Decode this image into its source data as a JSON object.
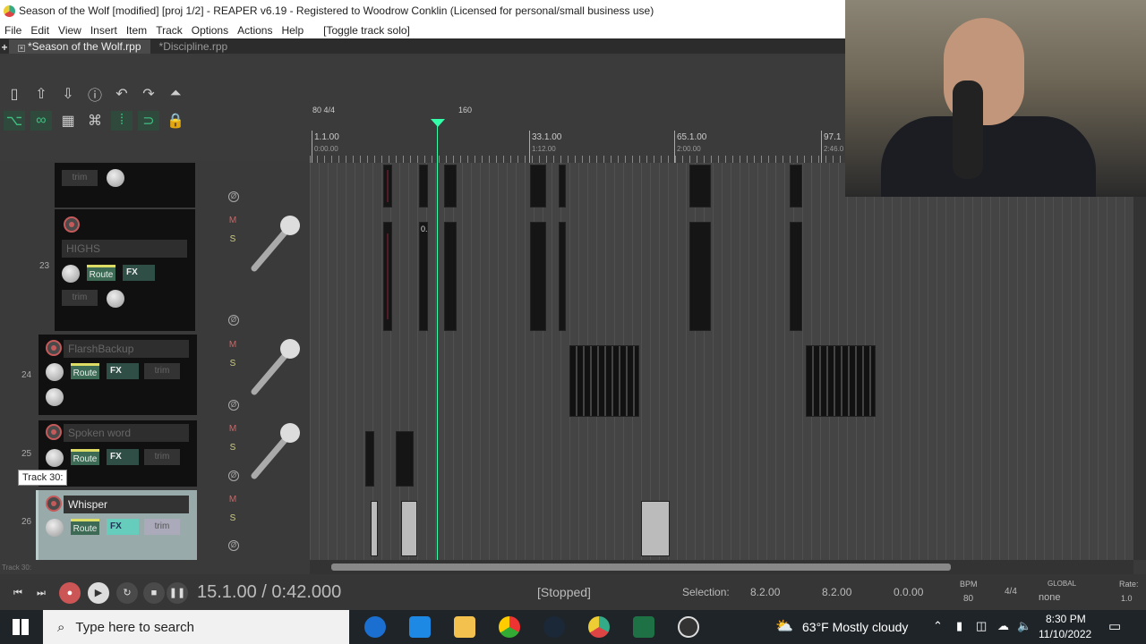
{
  "window": {
    "title": "Season of the Wolf [modified] [proj 1/2] - REAPER v6.19 - Registered to Woodrow Conklin (Licensed for personal/small business use)"
  },
  "menu": {
    "items": [
      "File",
      "Edit",
      "View",
      "Insert",
      "Item",
      "Track",
      "Options",
      "Actions",
      "Help"
    ],
    "toggle": "[Toggle track solo]"
  },
  "tabs": [
    {
      "label": "*Season of the Wolf.rpp",
      "active": true
    },
    {
      "label": "*Discipline.rpp",
      "active": false
    }
  ],
  "ruler": {
    "tempo_left": "80 4/4",
    "tempo_right": "160",
    "marks": [
      {
        "bar": "1.1.00",
        "time": "0:00.00"
      },
      {
        "bar": "33.1.00",
        "time": "1:12.00"
      },
      {
        "bar": "65.1.00",
        "time": "2:00.00"
      },
      {
        "bar": "97.1",
        "time": "2:46.0"
      }
    ]
  },
  "tracks": {
    "t22": {
      "trim": "trim"
    },
    "t23": {
      "number": "23",
      "name": "HIGHS",
      "route": "Route",
      "fx": "FX",
      "trim": "trim"
    },
    "t24": {
      "number": "24",
      "name": "FlarshBackup",
      "route": "Route",
      "fx": "FX",
      "trim": "trim"
    },
    "t25": {
      "number": "25",
      "name": "Spoken word",
      "route": "Route",
      "fx": "FX",
      "trim": "trim"
    },
    "t26": {
      "number": "26",
      "name": "Whisper",
      "route": "Route",
      "fx": "FX",
      "trim": "trim"
    }
  },
  "mixer": {
    "mute": "M",
    "solo": "S",
    "phase": "Ø"
  },
  "item_label": "0.",
  "tooltip": "Track 30:",
  "status_left": "Track 30:",
  "transport": {
    "position": "15.1.00 / 0:42.000",
    "state": "[Stopped]",
    "selection_label": "Selection:",
    "sel_start": "8.2.00",
    "sel_end": "8.2.00",
    "sel_len": "0.0.00",
    "bpm_label": "BPM",
    "bpm": "80",
    "timesig": "4/4",
    "global": "GLOBAL",
    "none": "none",
    "rate_label": "Rate:",
    "rate": "1.0"
  },
  "taskbar": {
    "search_placeholder": "Type here to search",
    "weather": "63°F  Mostly cloudy",
    "time": "8:30 PM",
    "date": "11/10/2022"
  }
}
